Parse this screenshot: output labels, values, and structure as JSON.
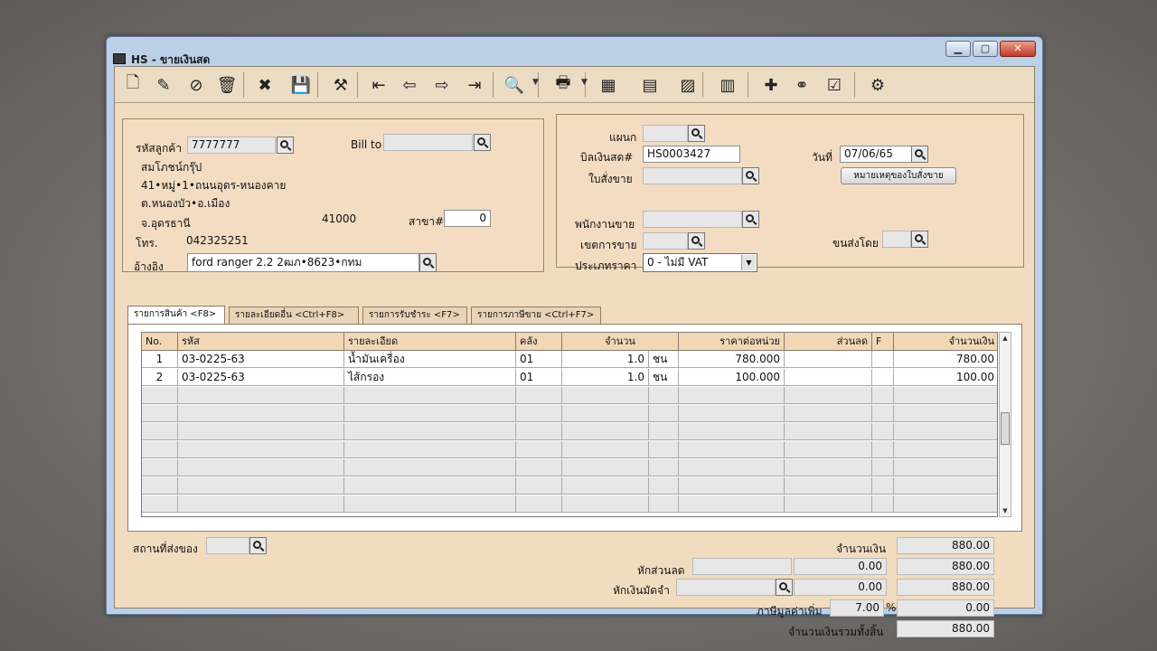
{
  "window": {
    "title": "HS - ขายเงินสด"
  },
  "toolbar": {
    "buttons": [
      {
        "name": "new-doc-icon",
        "glyph": "🗋"
      },
      {
        "name": "edit-doc-icon",
        "glyph": "✎"
      },
      {
        "name": "cancel-doc-icon",
        "glyph": "⊘"
      },
      {
        "name": "trash-icon",
        "glyph": "🗑"
      },
      {
        "name": "close-red-icon",
        "glyph": "✖"
      },
      {
        "name": "save-icon",
        "glyph": "💾"
      },
      {
        "name": "tools-icon",
        "glyph": "⚒"
      },
      {
        "name": "first-record-icon",
        "glyph": "⇤"
      },
      {
        "name": "prev-record-icon",
        "glyph": "⇦"
      },
      {
        "name": "next-record-icon",
        "glyph": "⇨"
      },
      {
        "name": "last-record-icon",
        "glyph": "⇥"
      },
      {
        "name": "search-doc-icon",
        "glyph": "🔍"
      },
      {
        "name": "print-icon",
        "glyph": "🖶"
      },
      {
        "name": "report-1-icon",
        "glyph": "▦"
      },
      {
        "name": "report-2-icon",
        "glyph": "▤"
      },
      {
        "name": "chart-icon",
        "glyph": "▨"
      },
      {
        "name": "calculator-icon",
        "glyph": "▥"
      },
      {
        "name": "approve-icon",
        "glyph": "✚"
      },
      {
        "name": "link-icon",
        "glyph": "⚭"
      },
      {
        "name": "ok-icon",
        "glyph": "☑"
      },
      {
        "name": "settings-icon",
        "glyph": "⚙"
      }
    ]
  },
  "customer": {
    "code_label": "รหัสลูกค้า",
    "code": "7777777",
    "bill_to_label": "Bill to",
    "bill_to": "",
    "name": "สมโภชน์กรุ๊ป",
    "address1": "41•หมู่•1•ถนนอุดร-หนองคาย",
    "address2": "ต.หนองบัว•อ.เมือง",
    "province": "จ.อุดรธานี",
    "postcode": "41000",
    "branch_label": "สาขา#",
    "branch": "0",
    "phone_label": "โทร.",
    "phone": "042325251",
    "ref_label": "อ้างอิง",
    "ref": "ford ranger 2.2 2ฒภ•8623•กทม"
  },
  "doc": {
    "dept_label": "แผนก",
    "dept": "",
    "bill_no_label": "บิลเงินสด#",
    "bill_no": "HS0003427",
    "order_label": "ใบสั่งขาย",
    "order": "",
    "date_label": "วันที่",
    "date": "07/06/65",
    "note_button": "หมายเหตุของใบสั่งขาย",
    "salesman_label": "พนักงานขาย",
    "salesman": "",
    "area_label": "เขตการขาย",
    "area": "",
    "ship_label": "ขนส่งโดย",
    "ship": "",
    "price_type_label": "ประเภทราคา",
    "price_type": "0 - ไม่มี VAT"
  },
  "tabs": [
    {
      "label": "รายการสินค้า <F8>"
    },
    {
      "label": "รายละเอียดอื่น <Ctrl+F8>"
    },
    {
      "label": "รายการรับชำระ <F7>"
    },
    {
      "label": "รายการภาษีขาย <Ctrl+F7>"
    }
  ],
  "grid": {
    "columns": [
      "No.",
      "รหัส",
      "รายละเอียด",
      "คลัง",
      "จำนวน",
      "ราคาต่อหน่วย",
      "ส่วนลด",
      "F",
      "จำนวนเงิน"
    ],
    "rows": [
      {
        "no": "1",
        "code": "03-0225-63",
        "desc": "น้ำมันเครื่อง",
        "wh": "01",
        "qty": "1.0",
        "unit": "ชน",
        "price": "780.000",
        "disc": "",
        "f": "",
        "amount": "780.00"
      },
      {
        "no": "2",
        "code": "03-0225-63",
        "desc": "ไส้กรอง",
        "wh": "01",
        "qty": "1.0",
        "unit": "ชน",
        "price": "100.000",
        "disc": "",
        "f": "",
        "amount": "100.00"
      }
    ]
  },
  "footer": {
    "place_label": "สถานที่ส่งของ",
    "place": "",
    "amount_label": "จำนวนเงิน",
    "amount": "880.00",
    "discount_label": "หักส่วนลด",
    "discount_text": "",
    "discount": "0.00",
    "after_discount": "880.00",
    "deposit_label": "หักเงินมัดจำ",
    "deposit_text": "",
    "deposit": "0.00",
    "after_deposit": "880.00",
    "vat_label": "ภาษีมูลค่าเพิ่ม",
    "vat_rate": "7.00",
    "vat_pct": "%",
    "vat_amount": "0.00",
    "total_label": "จำนวนเงินรวมทั้งสิ้น",
    "total": "880.00"
  }
}
